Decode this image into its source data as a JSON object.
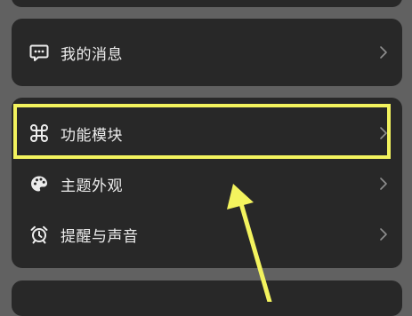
{
  "messages": {
    "label": "我的消息",
    "icon": "chat-bubble-icon"
  },
  "menu": {
    "items": [
      {
        "label": "功能模块",
        "icon": "command-key-icon",
        "highlighted": true
      },
      {
        "label": "主题外观",
        "icon": "palette-icon",
        "highlighted": false
      },
      {
        "label": "提醒与声音",
        "icon": "alarm-clock-icon",
        "highlighted": false
      }
    ]
  },
  "colors": {
    "background": "#616161",
    "card": "#282828",
    "text": "#ececec",
    "chevron": "#8e8e8e",
    "annotation": "#f3f35e"
  }
}
